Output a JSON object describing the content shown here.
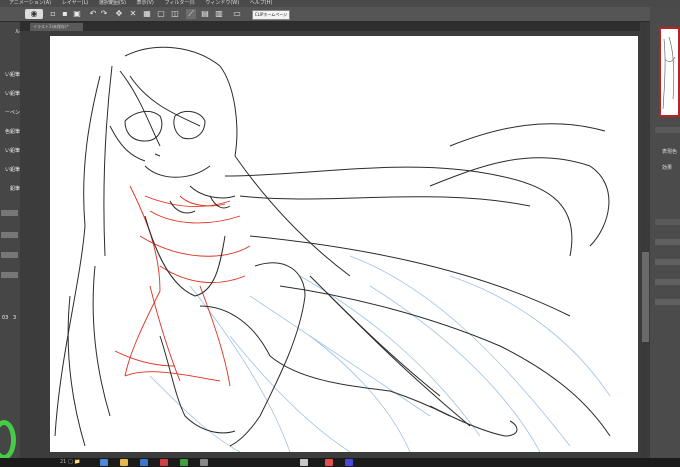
{
  "menu": [
    "アニメーション(A)",
    "レイヤー(L)",
    "選択範囲(S)",
    "表示(V)",
    "フィルター(I)",
    "ウィンドウ(W)",
    "ヘルプ(H)"
  ],
  "toolbar": {
    "home_label": "CLIPホームページ"
  },
  "document_tab": {
    "title": "イラスト1(未保存)*"
  },
  "left_panel": {
    "items": [
      "ル",
      "い鉛筆",
      "い鉛筆",
      "ーペン",
      "色鉛筆",
      "い鉛筆",
      "い鉛筆",
      "鉛筆"
    ],
    "brush_sizes": [
      "03",
      "3"
    ]
  },
  "right_panel": {
    "label1": "表現色",
    "label2": "効果"
  },
  "colors": {
    "accent": "#4cc84c",
    "nav_border": "#b22222"
  },
  "taskbar": {
    "text": "21 □ 📁"
  }
}
